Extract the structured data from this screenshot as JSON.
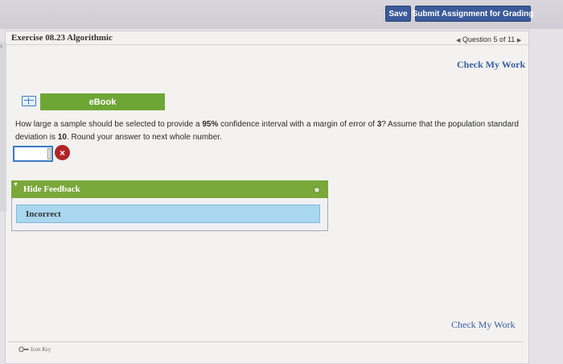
{
  "toolbar": {
    "save_label": "Save",
    "submit_label": "Submit Assignment for Grading"
  },
  "header": {
    "exercise_title": "Exercise 08.23 Algorithmic",
    "question_nav": "Question 5 of 11",
    "prev_icon": "triangle-left-icon",
    "next_icon": "triangle-right-icon"
  },
  "main": {
    "check_my_work_top": "Check My Work",
    "ebook_label": "eBook",
    "question": {
      "part1": "How large a sample should be selected to provide a ",
      "bold1": "95%",
      "part2": " confidence interval with a margin of error of ",
      "bold2": "3",
      "part3": "? Assume that the population standard deviation is ",
      "bold3": "10",
      "part4": ". Round your answer to next whole number."
    },
    "answer_value": "",
    "answer_status_icon": "incorrect-x-icon",
    "feedback": {
      "toggle_label": "Hide Feedback",
      "result_text": "Incorrect"
    },
    "check_my_work_bottom": "Check My Work"
  },
  "footer": {
    "key_label": "Icon Key"
  },
  "colors": {
    "accent_blue": "#3b5a9a",
    "green": "#6ea635",
    "incorrect_red": "#b02525",
    "feedback_blue": "#a9d7ef"
  }
}
